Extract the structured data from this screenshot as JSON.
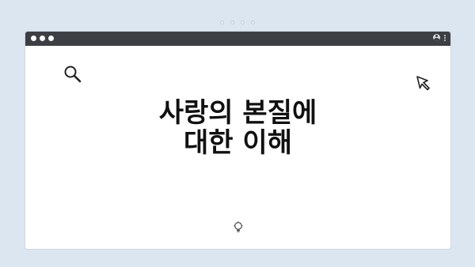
{
  "background_color": "#dce6f0",
  "page_indicator": {
    "dot_count": 4
  },
  "window": {
    "titlebar_color": "#3c3f44",
    "traffic_lights": [
      "dot",
      "dot",
      "dot"
    ],
    "right_icons": [
      "account-icon",
      "kebab-menu-icon"
    ]
  },
  "content": {
    "heading_line1": "사랑의 본질에",
    "heading_line2": "대한 이해",
    "icons": [
      "search-icon",
      "cursor-arrow-icon",
      "lightbulb-icon"
    ]
  }
}
